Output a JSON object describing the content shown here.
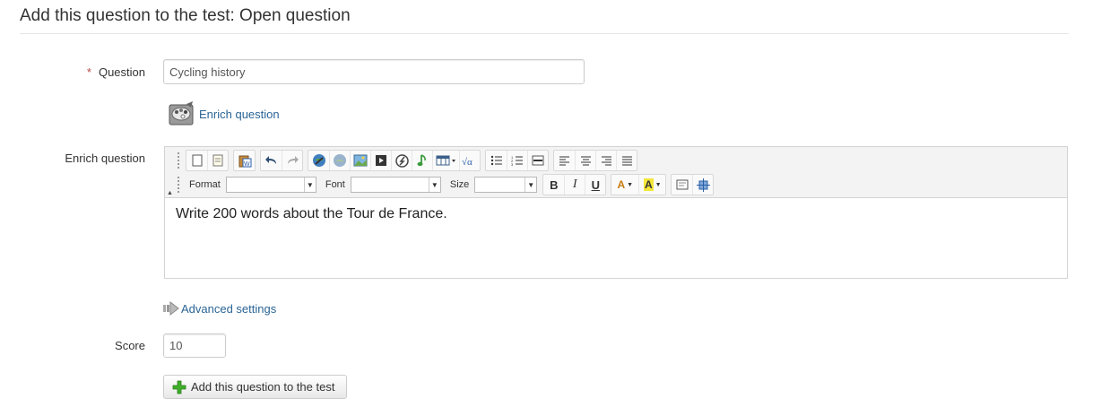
{
  "page": {
    "title": "Add this question to the test: Open question"
  },
  "form": {
    "question": {
      "required_mark": "*",
      "label": "Question",
      "value": "Cycling history"
    },
    "enrich_link": {
      "label": "Enrich question",
      "icon": "palette-icon"
    },
    "enrich": {
      "label": "Enrich question",
      "toolbar": {
        "row1_icons": [
          "new-page-icon",
          "templates-icon",
          "paste-word-icon",
          "undo-icon",
          "redo-icon",
          "link-icon",
          "unlink-icon",
          "image-icon",
          "video-icon",
          "flash-icon",
          "audio-icon",
          "table-icon",
          "math-formula-icon",
          "bulleted-list-icon",
          "numbered-list-icon",
          "horizontal-rule-icon",
          "align-left-icon",
          "align-center-icon",
          "align-right-icon",
          "justify-icon"
        ],
        "format_label": "Format",
        "font_label": "Font",
        "size_label": "Size",
        "bold": "B",
        "italic": "I",
        "underline": "U",
        "text_color": "A",
        "bg_color": "A",
        "row2_icons": [
          "source-icon",
          "maximize-icon"
        ]
      },
      "content": "Write 200 words about the Tour de France."
    },
    "advanced_settings": {
      "label": "Advanced settings"
    },
    "score": {
      "label": "Score",
      "value": "10"
    },
    "submit": {
      "label": "Add this question to the test"
    }
  },
  "colors": {
    "link": "#2a6496",
    "required": "#b94a48",
    "plus_green": "#3fae2a"
  }
}
